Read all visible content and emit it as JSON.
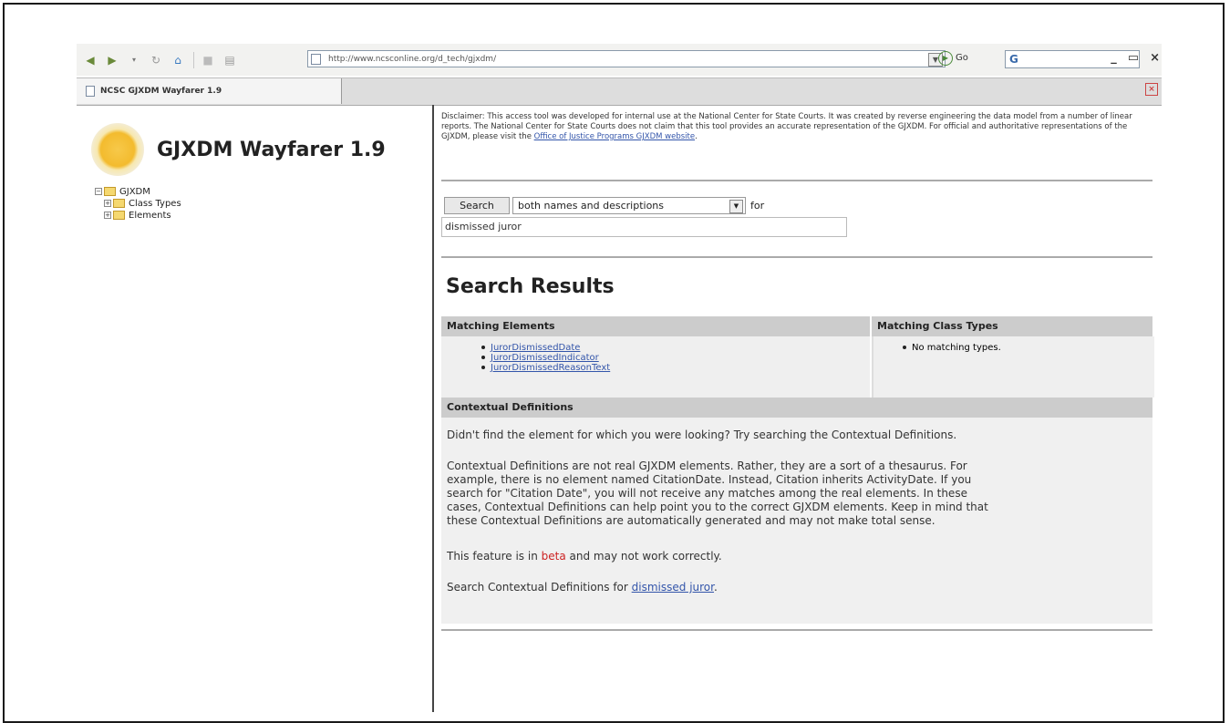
{
  "browser": {
    "address": "http://www.ncsconline.org/d_tech/gjxdm/",
    "go_label": "Go",
    "search_box": "G",
    "window_controls": [
      "_",
      "▭",
      "×"
    ],
    "tab_title": "NCSC GJXDM Wayfarer 1.9",
    "tab_close": "×"
  },
  "sidebar": {
    "app_title": "GJXDM Wayfarer 1.9",
    "tree": [
      {
        "label": "GJXDM",
        "toggle": "−"
      },
      {
        "label": "Class Types",
        "toggle": "+"
      },
      {
        "label": "Elements",
        "toggle": "+"
      }
    ]
  },
  "main": {
    "disclaimer_text": "Disclaimer: This access tool was developed for internal use at the National Center for State Courts. It was created by reverse engineering the data model from a number of linear reports. The National Center for State Courts does not claim that this tool provides an accurate representation of the GJXDM. For official and authoritative representations of the GJXDM, please visit the ",
    "disclaimer_link": "Office of Justice Programs GJXDM website",
    "disclaimer_end": ".",
    "search_button": "Search",
    "search_scope": "both names and descriptions",
    "for_label": "for",
    "search_value": "dismissed juror",
    "results_title": "Search Results",
    "matching_elements_header": "Matching Elements",
    "matching_class_types_header": "Matching Class Types",
    "elements": [
      "JurorDismissedDate",
      "JurorDismissedIndicator",
      "JurorDismissedReasonText"
    ],
    "class_types_empty": "No matching types.",
    "contextual_header": "Contextual Definitions",
    "ctx_p1": "Didn't find the element for which you were looking? Try searching the Contextual Definitions.",
    "ctx_p2_l1": "Contextual Definitions are not real GJXDM elements. Rather, they are a sort of a thesaurus. For",
    "ctx_p2_l2": "example, there is no element named CitationDate. Instead, Citation inherits ActivityDate. If you",
    "ctx_p2_l3": "search for \"Citation Date\", you will not receive any matches among the real elements. In these",
    "ctx_p2_l4": "cases, Contextual Definitions can help point you to the correct GJXDM elements. Keep in mind that",
    "ctx_p2_l5": "these Contextual Definitions are automatically generated and may not make total sense.",
    "beta_pre": "This feature is in ",
    "beta_word": "beta",
    "beta_post": " and may not work correctly.",
    "ctx_search_pre": "Search Contextual Definitions for ",
    "ctx_search_link": "dismissed juror",
    "ctx_search_post": "."
  }
}
